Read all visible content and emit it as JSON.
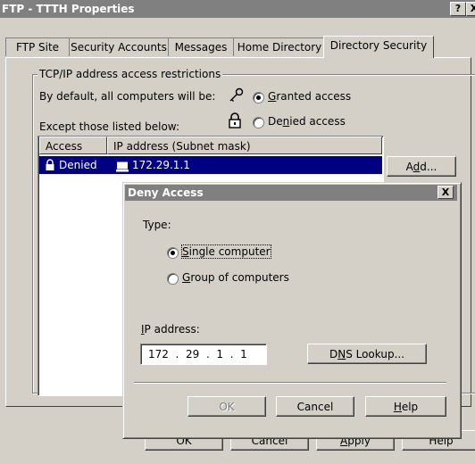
{
  "window": {
    "title": "FTP - TTTH Properties",
    "help_btn": "?",
    "close_btn": "X"
  },
  "tabs": [
    "FTP Site",
    "Security Accounts",
    "Messages",
    "Home Directory",
    "Directory Security"
  ],
  "group": {
    "label": "TCP/IP address access restrictions",
    "default_text": "By default, all computers will be:",
    "granted": {
      "pre": "",
      "u": "G",
      "post": "ranted access",
      "selected": true
    },
    "denied": {
      "pre": "De",
      "u": "n",
      "post": "ied access",
      "selected": false
    },
    "except_text": "Except  those listed below:"
  },
  "list": {
    "headers": [
      "Access",
      "IP address (Subnet mask)"
    ],
    "rows": [
      {
        "access": "Denied",
        "ip": "172.29.1.1"
      }
    ]
  },
  "add_button": {
    "pre": "A",
    "u": "d",
    "post": "d..."
  },
  "bottom_buttons": {
    "ok": "OK",
    "cancel": "Cancel",
    "apply": {
      "pre": "",
      "u": "A",
      "post": "pply"
    },
    "help": "Help"
  },
  "dialog": {
    "title": "Deny Access",
    "close_btn": "X",
    "type_label": "Type:",
    "single": {
      "pre": "",
      "u": "S",
      "post": "ingle computer",
      "selected": true
    },
    "group": {
      "pre": "",
      "u": "G",
      "post": "roup of computers",
      "selected": false
    },
    "ip_label": {
      "pre": "",
      "u": "I",
      "post": "P address:"
    },
    "ip_octets": [
      "172",
      "29",
      "1",
      "1"
    ],
    "dns_button": {
      "pre": "D",
      "u": "N",
      "post": "S Lookup..."
    },
    "ok": "OK",
    "cancel": "Cancel",
    "help": {
      "pre": "",
      "u": "H",
      "post": "elp"
    }
  }
}
